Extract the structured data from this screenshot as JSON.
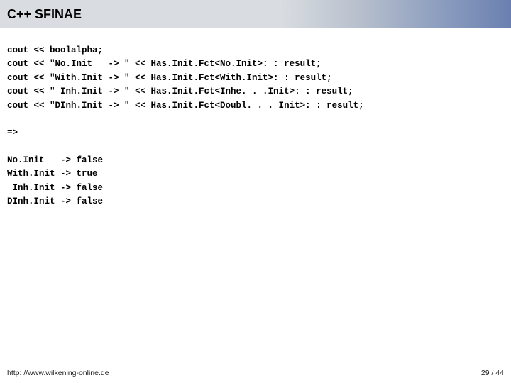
{
  "header": {
    "title": "C++ SFINAE"
  },
  "code": {
    "lines": [
      "cout << boolalpha;",
      "cout << \"No.Init   -> \" << Has.Init.Fct<No.Init>: : result;",
      "cout << \"With.Init -> \" << Has.Init.Fct<With.Init>: : result;",
      "cout << \" Inh.Init -> \" << Has.Init.Fct<Inhe. . .Init>: : result;",
      "cout << \"DInh.Init -> \" << Has.Init.Fct<Doubl. . . Init>: : result;",
      "",
      "=>",
      "",
      "No.Init   -> false",
      "With.Init -> true",
      " Inh.Init -> false",
      "DInh.Init -> false"
    ]
  },
  "footer": {
    "url": "http: //www.wilkening-online.de",
    "page": "29 / 44"
  }
}
